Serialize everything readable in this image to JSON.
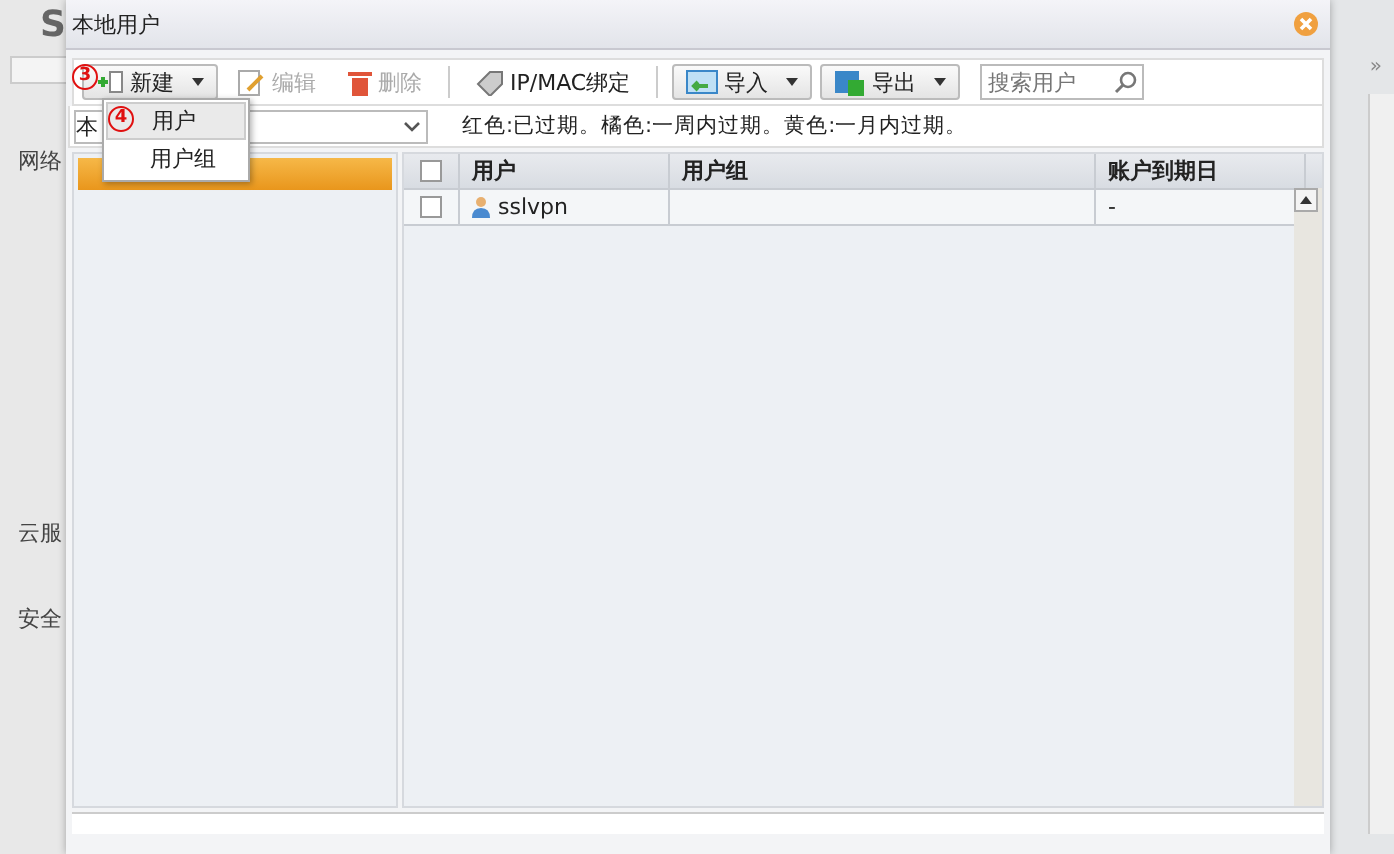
{
  "background": {
    "logo_letter": "S",
    "nav_groups": [
      {
        "label": "网络"
      },
      {
        "label": "云服"
      },
      {
        "label": "安全"
      }
    ],
    "collapse": "»"
  },
  "window": {
    "title": "本地用户"
  },
  "toolbar": {
    "buttons": [
      {
        "kind": "split",
        "label": "新建",
        "disabled": false
      },
      {
        "kind": "plain",
        "label": "编辑",
        "disabled": true
      },
      {
        "kind": "plain",
        "label": "删除",
        "disabled": true
      },
      {
        "kind": "plain",
        "label": "IP/MAC绑定",
        "disabled": false
      },
      {
        "kind": "split",
        "label": "导入",
        "disabled": false
      },
      {
        "kind": "split",
        "label": "导出",
        "disabled": false
      }
    ],
    "search": {
      "placeholder": "搜索用户"
    }
  },
  "filter": {
    "value": "本",
    "legend": "红色:已过期。橘色:一周内过期。黄色:一月内过期。"
  },
  "menu": {
    "items": [
      {
        "label": "用户",
        "selected": true
      },
      {
        "label": "用户组",
        "selected": false
      }
    ]
  },
  "markers": [
    {
      "label": "3"
    },
    {
      "label": "4"
    }
  ],
  "tree": {
    "items": [
      {
        "selected": true
      }
    ]
  },
  "table": {
    "all_checked": false,
    "columns": [
      "用户",
      "用户组",
      "账户到期日"
    ],
    "rows": [
      {
        "checked": false,
        "user": "sslvpn",
        "group": "",
        "expiry": "-"
      }
    ]
  }
}
